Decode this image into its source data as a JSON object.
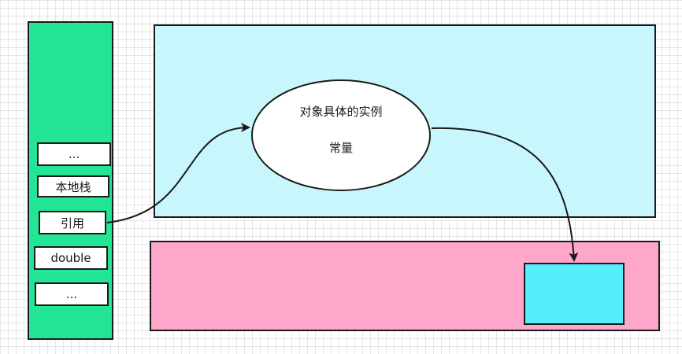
{
  "stack": {
    "slots": [
      "...",
      "本地栈",
      "引用",
      "double",
      "..."
    ]
  },
  "object": {
    "line1": "对象具体的实例",
    "line2": "常量"
  },
  "colors": {
    "stack_fill": "#22e596",
    "heap_top_fill": "#c7f7fd",
    "heap_bottom_fill": "#fea7cb",
    "target_fill": "#55eefd",
    "ellipse_fill": "#ffffff",
    "stroke": "#1a1a1a"
  }
}
